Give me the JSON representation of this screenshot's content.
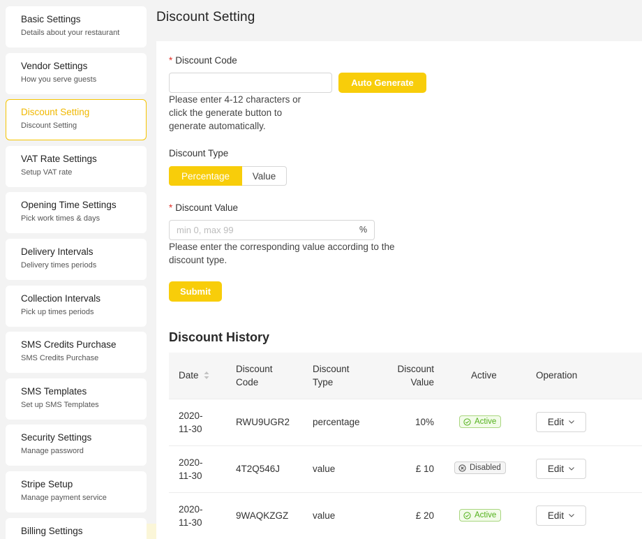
{
  "sidebar": {
    "items": [
      {
        "title": "Basic Settings",
        "subtitle": "Details about your restaurant"
      },
      {
        "title": "Vendor Settings",
        "subtitle": "How you serve guests"
      },
      {
        "title": "Discount Setting",
        "subtitle": "Discount Setting"
      },
      {
        "title": "VAT Rate Settings",
        "subtitle": "Setup VAT rate"
      },
      {
        "title": "Opening Time Settings",
        "subtitle": "Pick work times & days"
      },
      {
        "title": "Delivery Intervals",
        "subtitle": "Delivery times periods"
      },
      {
        "title": "Collection Intervals",
        "subtitle": "Pick up times periods"
      },
      {
        "title": "SMS Credits Purchase",
        "subtitle": "SMS Credits Purchase"
      },
      {
        "title": "SMS Templates",
        "subtitle": "Set up SMS Templates"
      },
      {
        "title": "Security Settings",
        "subtitle": "Manage password"
      },
      {
        "title": "Stripe Setup",
        "subtitle": "Manage payment service"
      },
      {
        "title": "Billing Settings",
        "subtitle": ""
      }
    ],
    "active_index": 2
  },
  "page": {
    "title": "Discount Setting"
  },
  "form": {
    "required_mark": "*",
    "code_label": "Discount Code",
    "code_value": "",
    "auto_generate_label": "Auto Generate",
    "code_help": [
      "Please enter 4-12 characters or",
      "click the generate button to",
      "generate automatically."
    ],
    "type_label": "Discount Type",
    "type_options": [
      "Percentage",
      "Value"
    ],
    "type_selected": "Percentage",
    "value_label": "Discount Value",
    "value_placeholder": "min 0, max 99",
    "value_suffix": "%",
    "value_help": [
      "Please enter the corresponding value according to the",
      "discount type."
    ],
    "submit_label": "Submit"
  },
  "history": {
    "title": "Discount History",
    "columns": {
      "date": "Date",
      "code": [
        "Discount",
        "Code"
      ],
      "type": [
        "Discount",
        "Type"
      ],
      "value": [
        "Discount",
        "Value"
      ],
      "active": "Active",
      "operation": "Operation"
    },
    "rows": [
      {
        "date": [
          "2020-",
          "11-30"
        ],
        "code": "RWU9UGR2",
        "type": "percentage",
        "value": "10%",
        "status": "Active",
        "operation": "Edit"
      },
      {
        "date": [
          "2020-",
          "11-30"
        ],
        "code": "4T2Q546J",
        "type": "value",
        "value": "£ 10",
        "status": "Disabled",
        "operation": "Edit"
      },
      {
        "date": [
          "2020-",
          "11-30"
        ],
        "code": "9WAQKZGZ",
        "type": "value",
        "value": "£ 20",
        "status": "Active",
        "operation": "Edit"
      }
    ]
  },
  "colors": {
    "accent": "#f8cd0a",
    "active_green": "#52b11b",
    "required_red": "#e0322a"
  }
}
